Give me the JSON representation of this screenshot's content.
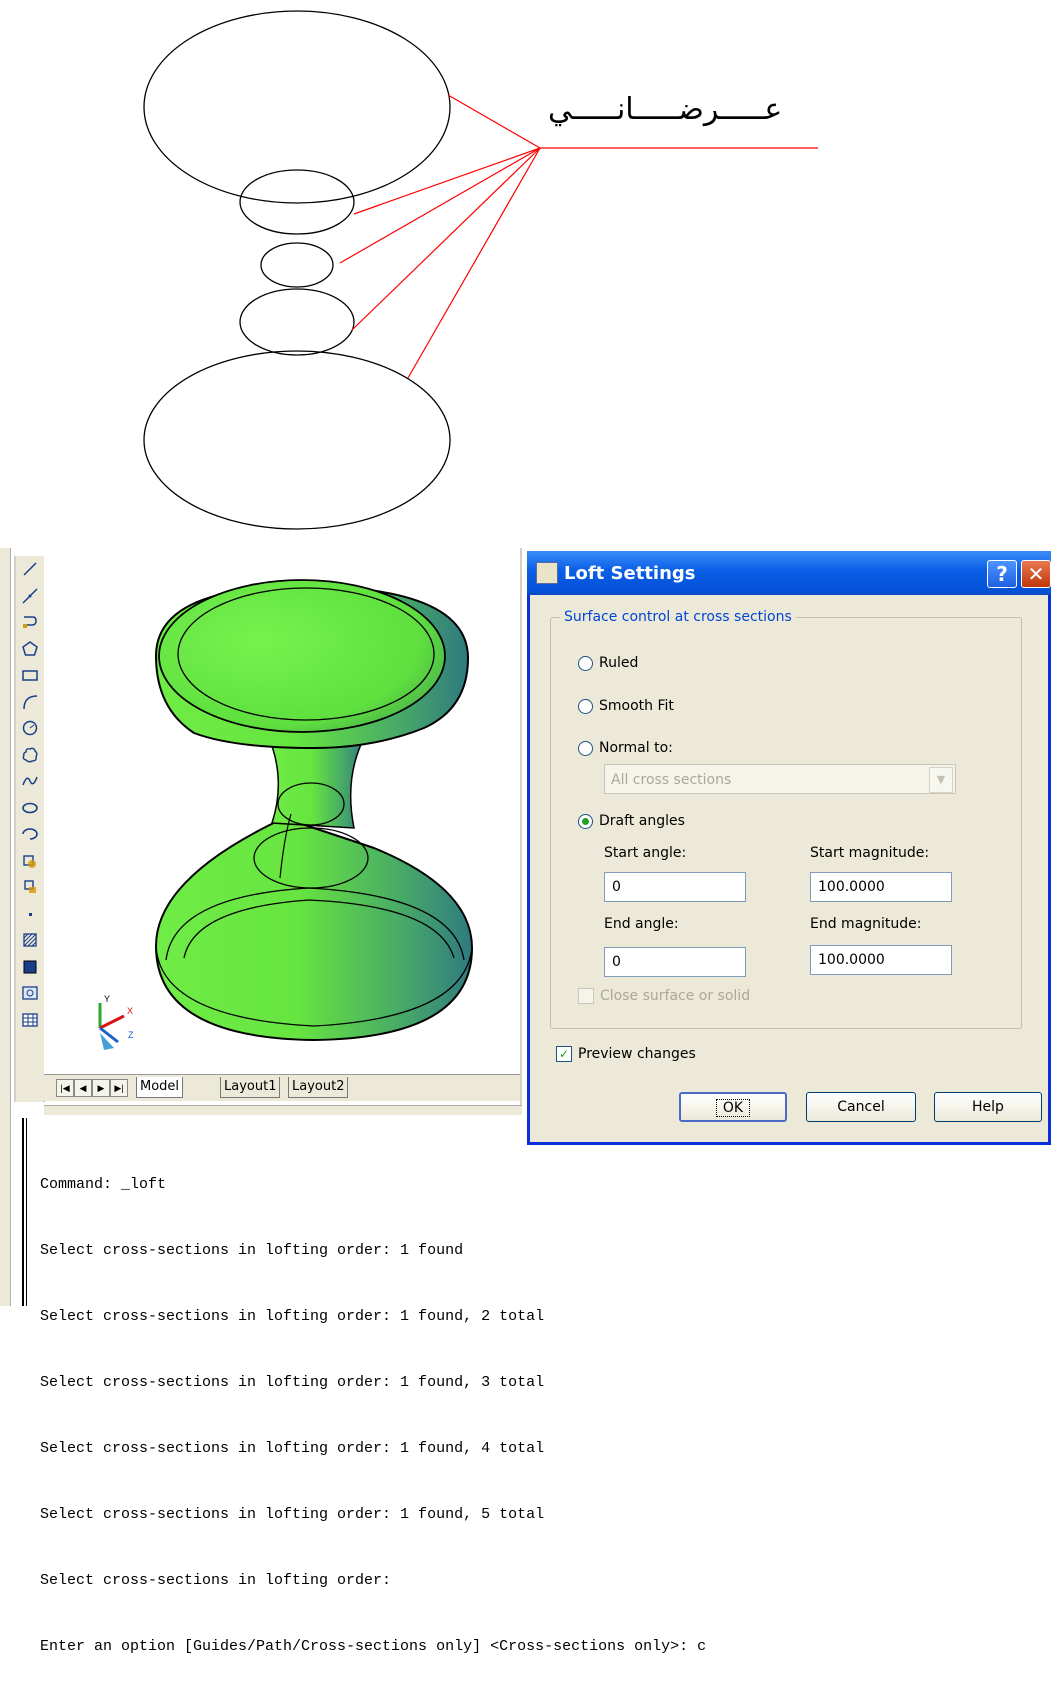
{
  "annotation": {
    "label": "عـــــرضـــــانـــــي"
  },
  "toolbar": {
    "icons": [
      "line-icon",
      "construction-line-icon",
      "polyline-icon",
      "polygon-icon",
      "rectangle-icon",
      "arc-icon",
      "circle-icon",
      "revision-cloud-icon",
      "spline-icon",
      "ellipse-icon",
      "ellipse-arc-icon",
      "insert-block-icon",
      "make-block-icon",
      "point-icon",
      "hatch-icon",
      "gradient-icon",
      "region-icon",
      "table-icon"
    ]
  },
  "ucs": {
    "x": "X",
    "y": "Y",
    "z": "Z"
  },
  "tabs": {
    "model": "Model",
    "layout1": "Layout1",
    "layout2": "Layout2"
  },
  "command_lines": [
    "Command: _loft",
    "Select cross-sections in lofting order: 1 found",
    "Select cross-sections in lofting order: 1 found, 2 total",
    "Select cross-sections in lofting order: 1 found, 3 total",
    "Select cross-sections in lofting order: 1 found, 4 total",
    "Select cross-sections in lofting order: 1 found, 5 total",
    "Select cross-sections in lofting order:",
    "Enter an option [Guides/Path/Cross-sections only] <Cross-sections only>: c"
  ],
  "dialog": {
    "title": "Loft Settings",
    "help_glyph": "?",
    "close_glyph": "✕",
    "group_label": "Surface control at cross sections",
    "ruled": "Ruled",
    "smooth_fit": "Smooth Fit",
    "normal_to": "Normal to:",
    "normal_to_value": "All cross sections",
    "draft_angles": "Draft angles",
    "start_angle_label": "Start angle:",
    "start_angle_value": "0",
    "start_magnitude_label": "Start magnitude:",
    "start_magnitude_value": "100.0000",
    "end_angle_label": "End angle:",
    "end_angle_value": "0",
    "end_magnitude_label": "End magnitude:",
    "end_magnitude_value": "100.0000",
    "close_surface": "Close surface or solid",
    "preview_changes": "Preview changes",
    "ok": "OK",
    "cancel": "Cancel",
    "help": "Help",
    "selected_option": "draft_angles",
    "preview_checked": true
  },
  "colors": {
    "solid_fill": "#66ee44",
    "solid_shade": "#3a8a7a",
    "leader_lines": "#ff0000",
    "title_bar": "#0a5ee6",
    "link_label": "#0046d5"
  }
}
